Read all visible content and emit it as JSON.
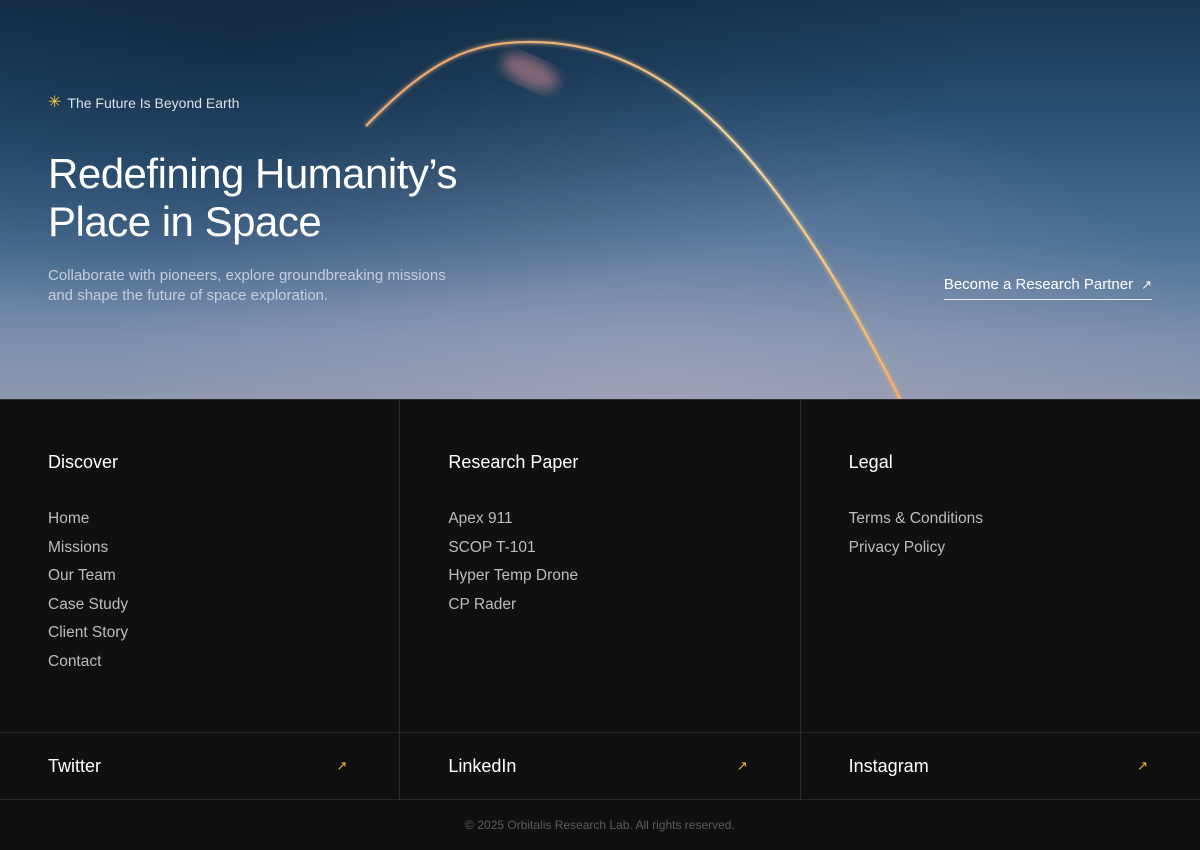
{
  "hero": {
    "eyebrow": "The Future Is Beyond Earth",
    "title_line1": "Redefining Humanity’s",
    "title_line2": "Place in Space",
    "subtitle_line1": "Collaborate with pioneers, explore groundbreaking missions",
    "subtitle_line2": "and shape the future of space exploration.",
    "cta_label": "Become a Research Partner",
    "arrow_glyph": "↗",
    "spark_glyph": "✳"
  },
  "footer": {
    "columns": [
      {
        "heading": "Discover",
        "items": [
          "Home",
          "Missions",
          "Our Team",
          "Case Study",
          "Client Story",
          "Contact"
        ]
      },
      {
        "heading": "Research Paper",
        "items": [
          "Apex 911",
          "SCOP T-101",
          "Hyper Temp Drone",
          "CP Rader"
        ]
      },
      {
        "heading": "Legal",
        "items": [
          "Terms & Conditions",
          "Privacy Policy"
        ]
      }
    ],
    "social": [
      {
        "name": "Twitter"
      },
      {
        "name": "LinkedIn"
      },
      {
        "name": "Instagram"
      }
    ],
    "copyright": "© 2025 Orbitalis Research Lab. All rights reserved."
  },
  "colors": {
    "accent": "#f2b13d",
    "background": "#101010",
    "border": "#2a2a2a"
  }
}
